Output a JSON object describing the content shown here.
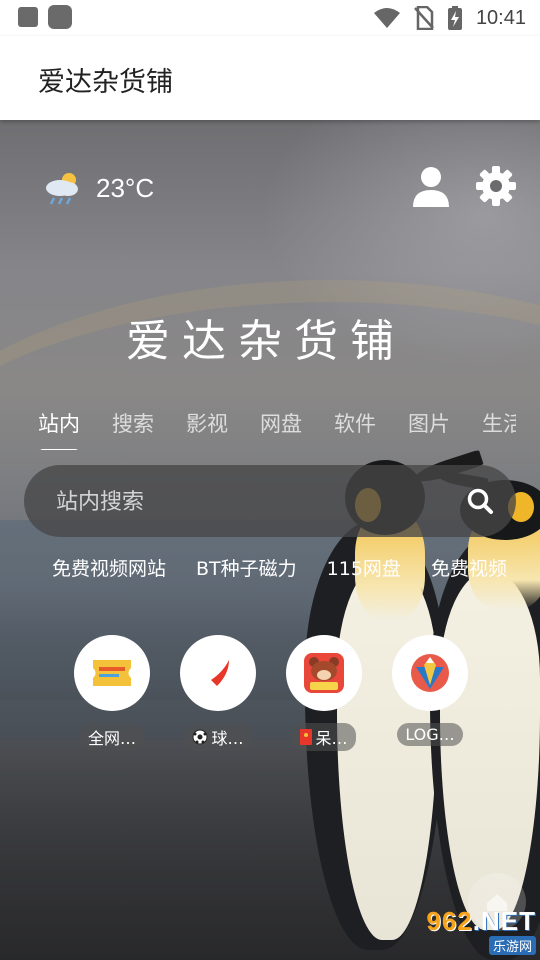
{
  "status_bar": {
    "time": "10:41"
  },
  "app_bar": {
    "title": "爱达杂货铺"
  },
  "weather": {
    "temperature": "23°C",
    "icon": "rain-sun-cloud-icon"
  },
  "header_icons": [
    "user-icon",
    "gear-icon"
  ],
  "hero": {
    "title": "爱达杂货铺"
  },
  "tabs": [
    {
      "label": "站内",
      "active": true
    },
    {
      "label": "搜索"
    },
    {
      "label": "影视"
    },
    {
      "label": "网盘"
    },
    {
      "label": "软件"
    },
    {
      "label": "图片"
    },
    {
      "label": "生活"
    }
  ],
  "search": {
    "placeholder": "站内搜索",
    "icon": "search-icon"
  },
  "quick_links": [
    "免费视频网站",
    "BT种子磁力",
    "115网盘",
    "免费视频"
  ],
  "apps": [
    {
      "label": "全网…",
      "icon": "ticket-app-icon"
    },
    {
      "label": "球…",
      "icon": "red-swoosh-app-icon",
      "badge": "soccer-ball-icon"
    },
    {
      "label": "呆…",
      "icon": "bear-app-icon",
      "badge": "red-envelope-icon"
    },
    {
      "label": "LOG…",
      "icon": "pencil-logo-app-icon"
    }
  ],
  "watermark": {
    "brand_num": "962",
    "brand_suffix": ".NET",
    "sub": "乐游网"
  },
  "colors": {
    "accent_orange": "#f6a21a",
    "watermark_blue": "#2a6db5"
  }
}
